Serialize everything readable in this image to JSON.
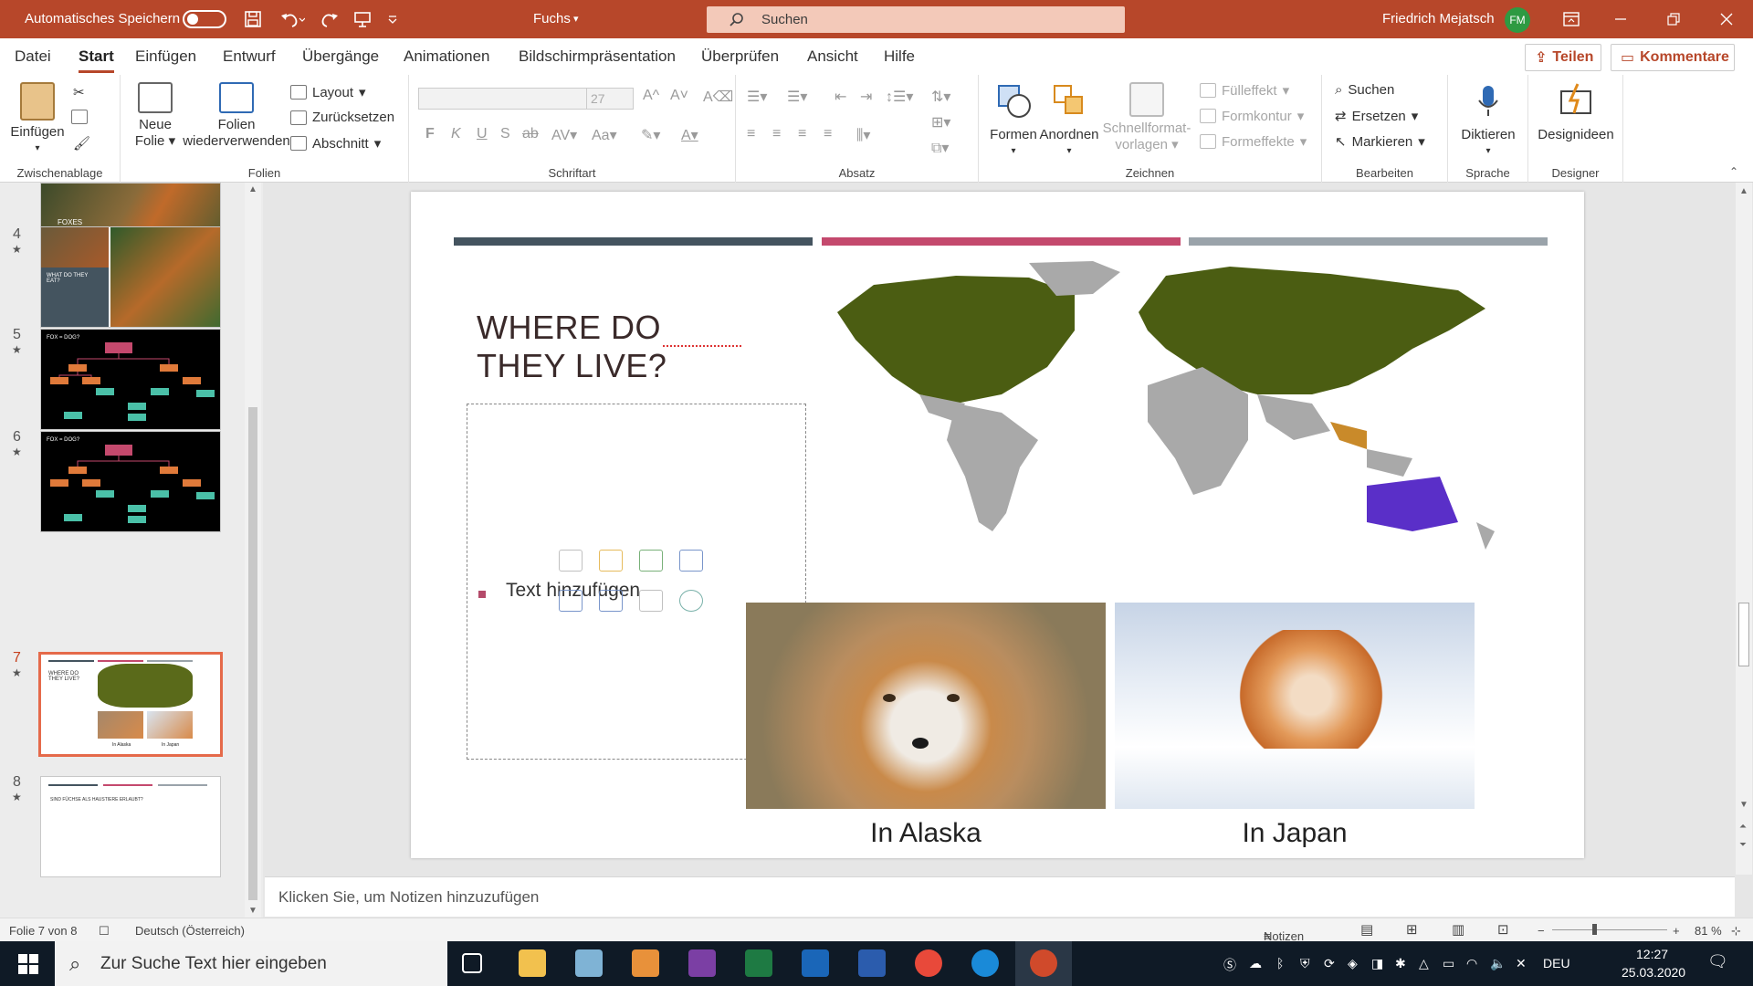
{
  "titlebar": {
    "autosave_label": "Automatisches Speichern",
    "doc_name": "Fuchs",
    "search_placeholder": "Suchen",
    "user_name": "Friedrich Mejatsch",
    "user_initials": "FM"
  },
  "tabs": [
    "Datei",
    "Start",
    "Einfügen",
    "Entwurf",
    "Übergänge",
    "Animationen",
    "Bildschirmpräsentation",
    "Überprüfen",
    "Ansicht",
    "Hilfe"
  ],
  "share_label": "Teilen",
  "comments_label": "Kommentare",
  "ribbon": {
    "clipboard": {
      "paste": "Einfügen",
      "group": "Zwischenablage"
    },
    "slides": {
      "new_slide_1": "Neue",
      "new_slide_2": "Folie",
      "reuse_1": "Folien",
      "reuse_2": "wiederverwenden",
      "layout": "Layout",
      "reset": "Zurücksetzen",
      "section": "Abschnitt",
      "group": "Folien"
    },
    "font": {
      "size": "27",
      "group": "Schriftart"
    },
    "paragraph": {
      "group": "Absatz"
    },
    "drawing": {
      "shapes": "Formen",
      "arrange": "Anordnen",
      "quick_styles_1": "Schnellformat-",
      "quick_styles_2": "vorlagen",
      "fill": "Fülleffekt",
      "outline": "Formkontur",
      "effects": "Formeffekte",
      "group": "Zeichnen"
    },
    "editing": {
      "find": "Suchen",
      "replace": "Ersetzen",
      "select": "Markieren",
      "group": "Bearbeiten"
    },
    "voice": {
      "dictate": "Diktieren",
      "group": "Sprache"
    },
    "designer": {
      "ideas": "Designideen",
      "group": "Designer"
    }
  },
  "thumbnails": [
    {
      "num": "4",
      "title": "WHAT DO THEY EAT?"
    },
    {
      "num": "5",
      "title": "FOX = DOG?"
    },
    {
      "num": "6",
      "title": "FOX = DOG?"
    },
    {
      "num": "7",
      "title": "WHERE DO THEY LIVE?",
      "cap1": "In Alaska",
      "cap2": "In Japan"
    },
    {
      "num": "8",
      "title": "SIND FÜCHSE ALS HAUSTIERE ERLAUBT?"
    }
  ],
  "thumb_fox_title": "FOXES",
  "slide": {
    "title": "WHERE DO THEY LIVE?",
    "placeholder": "Text hinzufügen",
    "caption_left": "In Alaska",
    "caption_right": "In Japan",
    "bar_colors": [
      "#44545f",
      "#c4496d",
      "#9aa3aa"
    ]
  },
  "notes_placeholder": "Klicken Sie, um Notizen hinzuzufügen",
  "status": {
    "slide_pos": "Folie 7 von 8",
    "language": "Deutsch (Österreich)",
    "notes": "Notizen",
    "zoom": "81 %"
  },
  "taskbar": {
    "search_placeholder": "Zur Suche Text hier eingeben",
    "lang": "DEU",
    "time": "12:27",
    "date": "25.03.2020"
  }
}
